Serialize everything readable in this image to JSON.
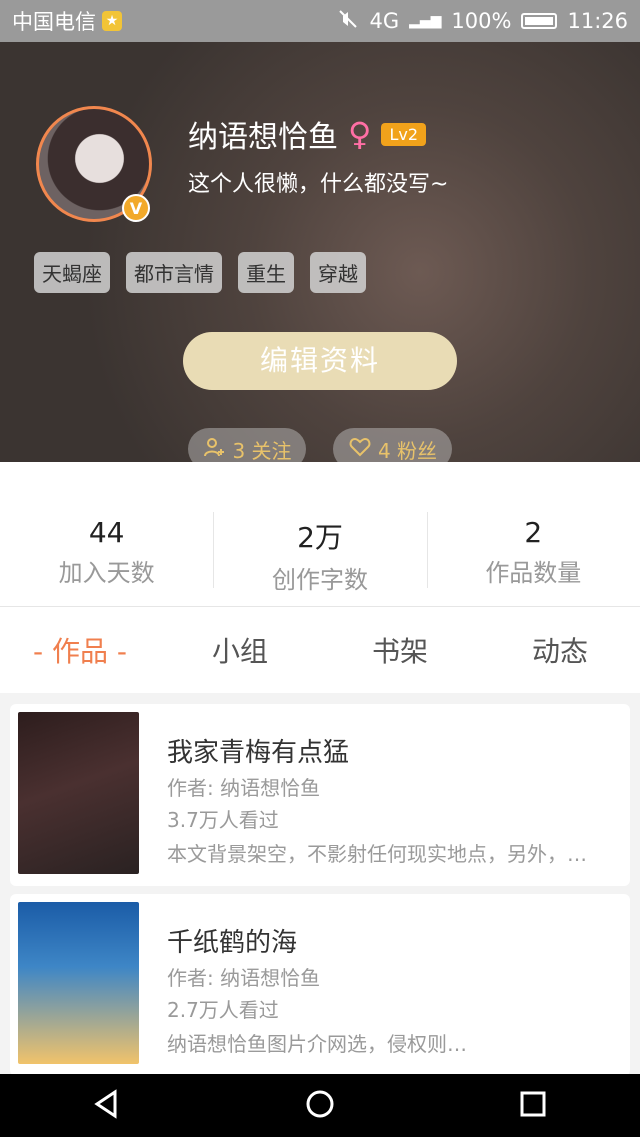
{
  "status_bar": {
    "carrier": "中国电信",
    "network": "4G",
    "battery": "100%",
    "time": "11:26",
    "badge": "★"
  },
  "profile": {
    "name": "纳语想恰鱼",
    "gender_symbol": "♀",
    "level": "Lv2",
    "verified_badge": "V",
    "bio": "这个人很懒，什么都没写~",
    "tags": [
      "天蝎座",
      "都市言情",
      "重生",
      "穿越"
    ],
    "edit_label": "编辑资料",
    "following_label": "3 关注",
    "followers_label": "4 粉丝"
  },
  "stats": [
    {
      "value": "44",
      "label": "加入天数"
    },
    {
      "value": "2万",
      "label": "创作字数"
    },
    {
      "value": "2",
      "label": "作品数量"
    }
  ],
  "tabs": [
    "- 作品 -",
    "小组",
    "书架",
    "动态"
  ],
  "books": [
    {
      "title": "我家青梅有点猛",
      "author": "作者: 纳语想恰鱼",
      "views": "3.7万人看过",
      "desc": "本文背景架空，不影射任何现实地点，另外，…"
    },
    {
      "title": "千纸鹤的海",
      "author": "作者: 纳语想恰鱼",
      "views": "2.7万人看过",
      "desc": "纳语想恰鱼图片介网选，侵权则…"
    }
  ],
  "colors": {
    "accent": "#f07f4e",
    "gold": "#e9dcb5",
    "level": "#f1a21b"
  }
}
